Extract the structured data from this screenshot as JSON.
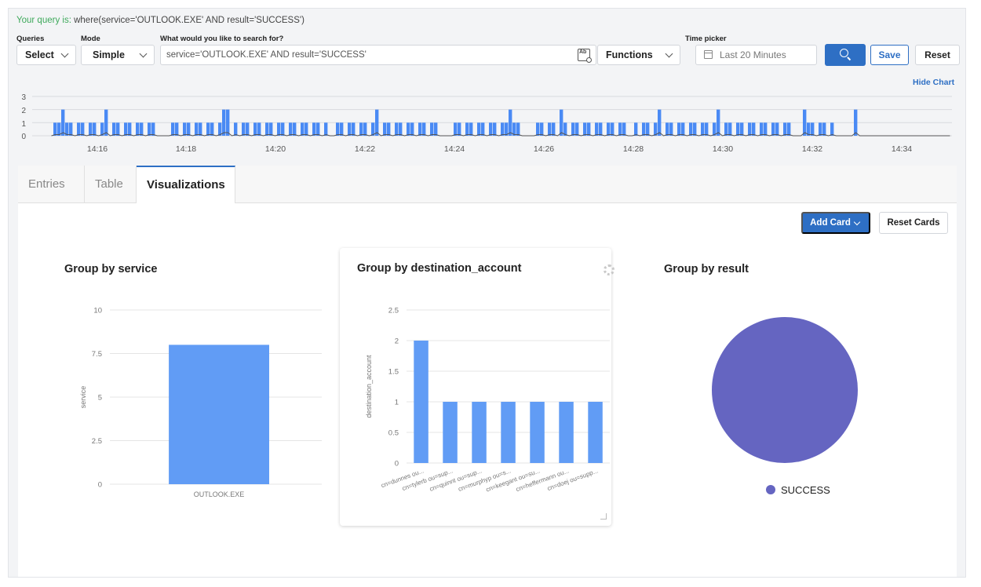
{
  "query": {
    "prefix": "Your query is:",
    "text": " where(service='OUTLOOK.EXE' AND result='SUCCESS')"
  },
  "labels": {
    "queries": "Queries",
    "mode": "Mode",
    "search": "What would you like to search for?",
    "time_picker": "Time picker"
  },
  "controls": {
    "queries_value": "Select",
    "mode_value": "Simple",
    "search_value": "service='OUTLOOK.EXE' AND result='SUCCESS'",
    "functions_label": "Functions",
    "time_value": "Last 20 Minutes",
    "save_label": "Save",
    "reset_label": "Reset",
    "hide_chart_label": "Hide Chart"
  },
  "timeline": {
    "y_ticks": [
      "3",
      "2",
      "1",
      "0"
    ],
    "x_ticks": [
      "14:16",
      "14:18",
      "14:20",
      "14:22",
      "14:24",
      "14:26",
      "14:28",
      "14:30",
      "14:32",
      "14:34"
    ],
    "bar_color": "#4a8af4"
  },
  "tabs": [
    {
      "label": "Entries"
    },
    {
      "label": "Table"
    },
    {
      "label": "Visualizations"
    }
  ],
  "toolbar": {
    "add_card_label": "Add Card",
    "reset_cards_label": "Reset Cards"
  },
  "cards": {
    "service": {
      "title": "Group by service"
    },
    "destination": {
      "title": "Group by destination_account"
    },
    "result": {
      "title": "Group by result",
      "legend": "SUCCESS"
    }
  },
  "colors": {
    "accent": "#2e6fc4",
    "bar": "#619cf5",
    "pie": "#6565c1",
    "query_label": "#3ea95b"
  },
  "chart_data": [
    {
      "type": "bar",
      "title": "Group by service",
      "ylabel": "service",
      "categories": [
        "OUTLOOK.EXE"
      ],
      "values": [
        8
      ],
      "ylim": [
        0,
        10
      ],
      "y_ticks": [
        "10",
        "7.5",
        "5",
        "2.5",
        "0"
      ],
      "grid": true
    },
    {
      "type": "bar",
      "title": "Group by destination_account",
      "ylabel": "destination_account",
      "categories": [
        "cn=dunnes ou...",
        "cn=tylerb ou=sup...",
        "cn=quinnt ou=sup...",
        "cn=murphyp ou=s...",
        "cn=keegant ou=su...",
        "cn=heffermann ou...",
        "cn=doej ou=supp..."
      ],
      "values": [
        2,
        1,
        1,
        1,
        1,
        1,
        1
      ],
      "ylim": [
        0,
        2.5
      ],
      "y_ticks": [
        "2.5",
        "2",
        "1.5",
        "1",
        "0.5",
        "0"
      ],
      "grid": true
    },
    {
      "type": "pie",
      "title": "Group by result",
      "categories": [
        "SUCCESS"
      ],
      "values": [
        8
      ],
      "legend": "bottom"
    }
  ]
}
